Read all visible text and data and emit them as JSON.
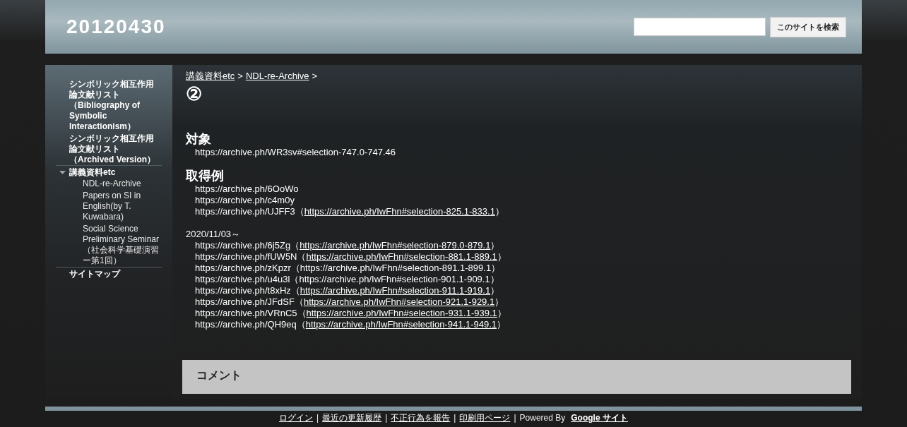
{
  "site_title": "20120430",
  "search": {
    "button": "このサイトを検索"
  },
  "sidebar": {
    "items": [
      {
        "label": "シンボリック相互作用論文献リスト（Bibliography of Symbolic Interactionism）"
      },
      {
        "label": "シンボリック相互作用論文献リスト（Archived Version）"
      },
      {
        "label": "講義資料etc",
        "expanded": true,
        "children": [
          {
            "label": "NDL-re-Archive"
          },
          {
            "label": "Papers on SI in English(by T. Kuwabara)"
          },
          {
            "label": "Social Science Preliminary Seminar（社会科学基礎演習ー第1回）"
          }
        ]
      },
      {
        "label": "サイトマップ"
      }
    ]
  },
  "breadcrumb": [
    {
      "label": "講義資料etc",
      "sep": ">"
    },
    {
      "label": "NDL-re-Archive",
      "sep": ">"
    }
  ],
  "page_title": "②",
  "blocks": [
    {
      "kind": "heading",
      "text": "対象"
    },
    {
      "kind": "entry",
      "before": "https://archive.ph/WR3sv#selection-747.0-747.46"
    },
    {
      "kind": "heading",
      "text": "取得例"
    },
    {
      "kind": "entry",
      "before": "https://archive.ph/6OoWo"
    },
    {
      "kind": "entry",
      "before": "https://archive.ph/c4m0y"
    },
    {
      "kind": "entry",
      "before": "https://archive.ph/UJFF3（",
      "ref": "https://archive.ph/IwFhn#selection-825.1-833.1",
      "after": "）",
      "ref_linked": true
    },
    {
      "kind": "note",
      "text": "2020/11/03～"
    },
    {
      "kind": "entry",
      "before": "https://archive.ph/6j5Zg（",
      "ref": "https://archive.ph/IwFhn#selection-879.0-879.1",
      "after": "）",
      "ref_linked": true
    },
    {
      "kind": "entry",
      "before": "https://archive.ph/fUW5N（",
      "ref": "https://archive.ph/IwFhn#selection-881.1-889.1",
      "after": "）",
      "ref_linked": true
    },
    {
      "kind": "entry",
      "before": "https://archive.ph/zKpzr（",
      "ref": "https://archive.ph/IwFhn#selection-891.1-899.1",
      "after": "）",
      "ref_linked": false
    },
    {
      "kind": "entry",
      "before": "https://archive.ph/u4u3l（",
      "ref": "https://archive.ph/IwFhn#selection-901.1-909.1",
      "after": "）",
      "ref_linked": false
    },
    {
      "kind": "entry",
      "before": "https://archive.ph/t8xHz（",
      "ref": "https://archive.ph/IwFhn#selection-911.1-919.1",
      "after": "）",
      "ref_linked": true
    },
    {
      "kind": "entry",
      "before": "https://archive.ph/JFdSF（",
      "ref": "https://archive.ph/IwFhn#selection-921.1-929.1",
      "after": "）",
      "ref_linked": true
    },
    {
      "kind": "entry",
      "before": "https://archive.ph/VRnC5（",
      "ref": "https://archive.ph/IwFhn#selection-931.1-939.1",
      "after": "）",
      "ref_linked": true
    },
    {
      "kind": "entry",
      "before": "https://archive.ph/QH9eq（",
      "ref": "https://archive.ph/IwFhn#selection-941.1-949.1",
      "after": "）",
      "ref_linked": true
    }
  ],
  "comments_title": "コメント",
  "footer": {
    "links": [
      {
        "label": "ログイン",
        "sep": "|"
      },
      {
        "label": "最近の更新履歴",
        "sep": "|"
      },
      {
        "label": "不正行為を報告",
        "sep": "|"
      },
      {
        "label": "印刷用ページ",
        "sep": "|"
      }
    ],
    "powered": "Powered By",
    "brand": "Google サイト"
  }
}
